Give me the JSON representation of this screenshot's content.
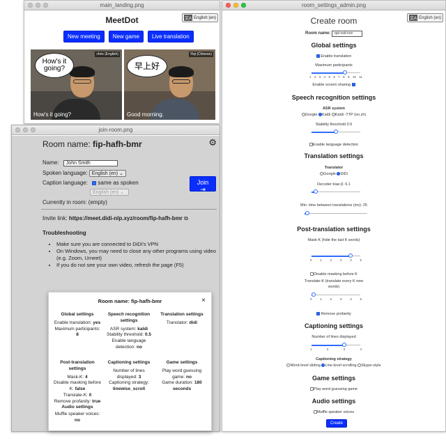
{
  "landing": {
    "file": "main_landing.png",
    "app_title": "MeetDot",
    "lang_button": "English (en)",
    "buttons": [
      "New meeting",
      "New game",
      "Live translation"
    ],
    "video_left": {
      "name": "chris (English)",
      "bubble": "How's it going?",
      "caption": "How's it going?"
    },
    "video_right": {
      "name": "Yiqi (Chinese)",
      "bubble": "早上好",
      "caption": "Good morning."
    }
  },
  "join": {
    "file": "join-room.png",
    "room_label": "Room name:",
    "room_name": "fip-hafh-bmr",
    "name_label": "Name:",
    "name_value": "John Smith",
    "spoken_label": "Spoken language:",
    "spoken_value": "English (en)",
    "caption_label": "Caption language:",
    "same_as_spoken": "same as spoken",
    "caption_value": "English (en)",
    "join_button": "Join",
    "current_label": "Currently in room: (empty)",
    "invite_label": "Invite link:",
    "invite_link": "https://meet.didi-nlp.xyz/room/fip-hafh-bmr",
    "troubleshooting_title": "Troubleshooting",
    "tips": [
      "Make sure you are connected to DiDi's VPN",
      "On Windows, you may need to close any other programs using video (e.g. Zoom, Umeet)",
      "If you do not see your own video, refresh the page (F5)"
    ]
  },
  "modal": {
    "title": "Room name: fip-hafh-bmr",
    "close": "×",
    "global": {
      "head": "Global settings",
      "l1": "Enable translation:",
      "v1": "yes",
      "l2": "Maximum participants:",
      "v2": "8"
    },
    "speech": {
      "head": "Speech recognition settings",
      "l1": "ASR system:",
      "v1": "kaldi",
      "l2": "Stability threshold:",
      "v2": "0.5",
      "l3": "Enable language detection:",
      "v3": "no"
    },
    "translation": {
      "head": "Translation settings",
      "l1": "Translator:",
      "v1": "didi"
    },
    "post": {
      "head": "Post-translation settings",
      "l1": "Mask-K:",
      "v1": "4",
      "l2": "Disable masking before K:",
      "v2": "false",
      "l3": "Translate-K:",
      "v3": "0",
      "l4": "Remove profanity:",
      "v4": "true"
    },
    "captioning": {
      "head": "Captioning settings",
      "l1": "Number of lines displayed:",
      "v1": "3",
      "l2": "Captioning strategy:",
      "v2": "linewise_scroll"
    },
    "game": {
      "head": "Game settings",
      "l1": "Play word guessing game:",
      "v1": "no",
      "l2": "Game duration:",
      "v2": "180 seconds"
    },
    "audio": {
      "head": "Audio settings",
      "l1": "Muffle speaker voices:",
      "v1": "no"
    }
  },
  "admin": {
    "file": "room_settings_admin.png",
    "lang_button": "English (en)",
    "title": "Create room",
    "room_label": "Room name:",
    "room_value": "qut-vsd-nce",
    "global_head": "Global settings",
    "enable_translation": "Enable translation",
    "max_participants": "Maximum participants",
    "max_ticks": [
      "1",
      "2",
      "3",
      "4",
      "5",
      "6",
      "7",
      "8",
      "9",
      "10",
      "11"
    ],
    "enable_screen_sharing": "Enable screen sharing",
    "speech_head": "Speech recognition settings",
    "asr_label": "ASR system",
    "asr_options": [
      "Google",
      "Kaldi",
      "Kaldi -TTP (en,zh)"
    ],
    "stability_label": "Stability threshold 0.5",
    "enable_lang_detection": "Enable language detection",
    "translation_head": "Translation settings",
    "translator_label": "Translator",
    "translator_options": [
      "Google",
      "DiDi"
    ],
    "decoder_label": "Decoder bias β: 0.1",
    "min_time_label": "Min. time between translations (ms): 25",
    "post_head": "Post-translation settings",
    "mask_k": "Mask-K (hide the last K words)",
    "mask_ticks": [
      "0",
      "1",
      "2",
      "3",
      "4",
      "5"
    ],
    "disable_masking": "Disable masking before K",
    "translate_k": "Translate-K (translate every K new words)",
    "translate_ticks": [
      "0",
      "1",
      "2",
      "3",
      "4",
      "5"
    ],
    "remove_profanity": "Remove profanity",
    "captioning_head": "Captioning settings",
    "lines_label": "Number of lines displayed",
    "lines_ticks": [
      "1",
      "2",
      "3",
      "4"
    ],
    "strategy_label": "Captioning strategy",
    "strategy_options": [
      "Word-level sliding",
      "Line-level scrolling",
      "Skype-style"
    ],
    "game_head": "Game settings",
    "play_game": "Play word guessing game",
    "audio_head": "Audio settings",
    "muffle": "Muffle speaker voices",
    "create_button": "Create"
  },
  "colors": {
    "accent": "#0a2eff",
    "checkbox": "#2d6cff",
    "join_bg": "#d3d3d3"
  }
}
